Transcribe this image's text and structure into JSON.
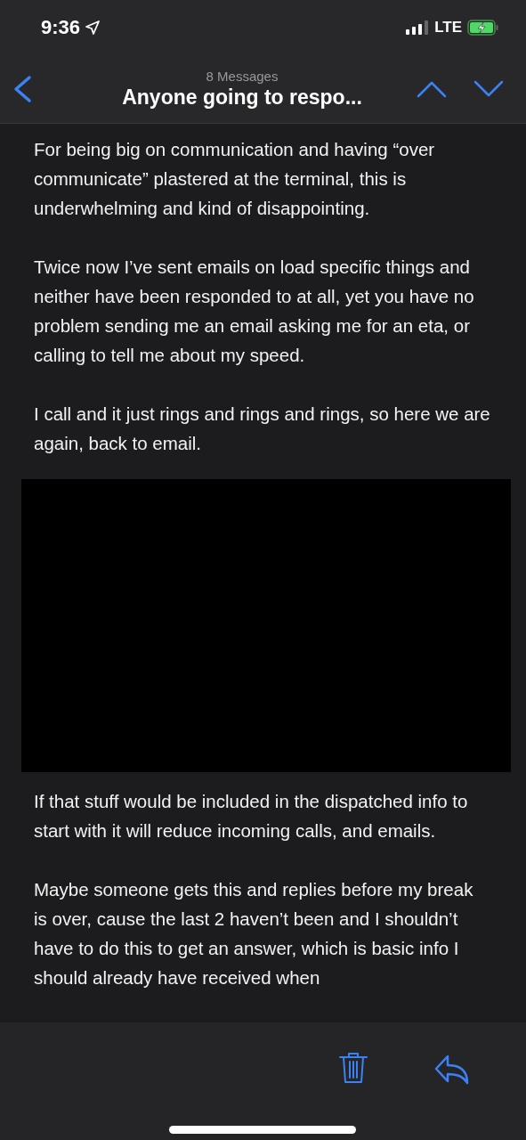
{
  "status_bar": {
    "time": "9:36",
    "network": "LTE"
  },
  "header": {
    "count": "8 Messages",
    "subject": "Anyone going to respo..."
  },
  "body": {
    "paragraphs_before": [
      "For being big on communication and having “over communicate” plastered at the terminal, this is underwhelming and kind of disappointing.",
      "Twice now I’ve sent emails on load specific things and neither have been responded to at all, yet you have no problem sending me an email asking me for an eta, or calling to tell me about my speed.",
      "I call and it just rings and rings and rings, so here we are again, back to email."
    ],
    "paragraphs_after": [
      "If that stuff would be included in the dispatched info to start with it will reduce incoming calls, and emails.",
      "Maybe someone gets this and replies before my break is over, cause the last 2 haven’t been and I shouldn’t have to do this to get an answer, which is basic info I should already have received when"
    ]
  }
}
